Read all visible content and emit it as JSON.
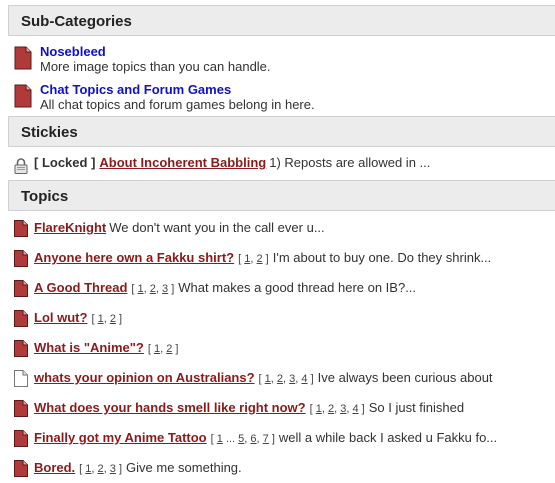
{
  "subcategories": {
    "header": "Sub-Categories",
    "items": [
      {
        "title": "Nosebleed",
        "description": "More image topics than you can handle."
      },
      {
        "title": "Chat Topics and Forum Games",
        "description": "All chat topics and forum games belong in here."
      }
    ]
  },
  "stickies": {
    "header": "Stickies",
    "items": [
      {
        "locked_label": "[ Locked ]",
        "title": "About Incoherent Babbling",
        "excerpt": "1) Reposts are allowed in ..."
      }
    ]
  },
  "topics": {
    "header": "Topics",
    "items": [
      {
        "title": "FlareKnight",
        "pages": [],
        "excerpt": "We don't want you in the call ever u...",
        "icon": "doc-red"
      },
      {
        "title": "Anyone here own a Fakku shirt?",
        "pages": [
          "1",
          "2"
        ],
        "excerpt": "I'm about to buy one. Do they shrink...",
        "icon": "doc-red"
      },
      {
        "title": "A Good Thread",
        "pages": [
          "1",
          "2",
          "3"
        ],
        "excerpt": "What makes a good thread here on IB?...",
        "icon": "doc-red"
      },
      {
        "title": "Lol wut?",
        "pages": [
          "1",
          "2"
        ],
        "excerpt": "",
        "icon": "doc-red"
      },
      {
        "title": "What is \"Anime\"?",
        "pages": [
          "1",
          "2"
        ],
        "excerpt": "",
        "icon": "doc-red"
      },
      {
        "title": "whats your opinion on Australians?",
        "pages": [
          "1",
          "2",
          "3",
          "4"
        ],
        "excerpt": "Ive always been curious about",
        "icon": "doc-white"
      },
      {
        "title": "What does your hands smell like right now?",
        "pages": [
          "1",
          "2",
          "3",
          "4"
        ],
        "excerpt": "So I just finished",
        "icon": "doc-red"
      },
      {
        "title": "Finally got my Anime Tattoo",
        "pages": [
          "1",
          "...",
          "5",
          "6",
          "7"
        ],
        "excerpt": "well a while back I asked u Fakku fo...",
        "icon": "doc-red"
      },
      {
        "title": "Bored.",
        "pages": [
          "1",
          "2",
          "3"
        ],
        "excerpt": "Give me something.",
        "icon": "doc-red"
      }
    ]
  },
  "colors": {
    "header_bg": "#ececec",
    "subcategory_link": "#1010c8",
    "topic_link": "#8b1a1a",
    "doc_icon_red": "#b03a3a"
  }
}
